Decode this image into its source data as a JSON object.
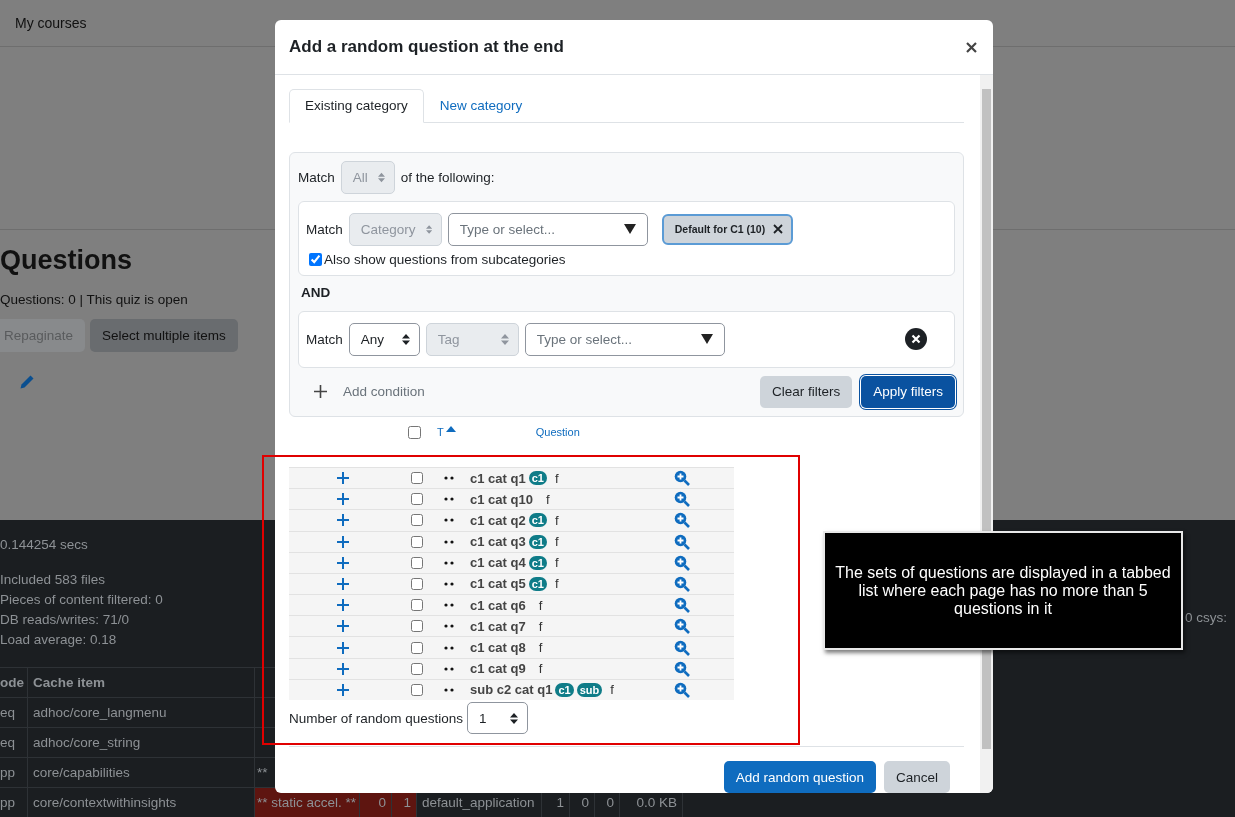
{
  "page": {
    "nav_link": "My courses",
    "heading": "Questions",
    "summary": "Questions: 0 | This quiz is open",
    "buttons": [
      {
        "label": "Repaginate",
        "disabled": true
      },
      {
        "label": "Select multiple items",
        "disabled": false
      }
    ]
  },
  "footer": {
    "stats": [
      "0.144254 secs",
      "Included 583 files",
      "Pieces of content filtered: 0",
      "DB reads/writes: 71/0",
      "Load average: 0.18"
    ],
    "side_stat": "0 csys:",
    "table": {
      "columns": [
        "ode",
        "Cache item"
      ],
      "rows": [
        {
          "cells": [
            "eq",
            "adhoc/core_langmenu"
          ],
          "flagged": false
        },
        {
          "cells": [
            "eq",
            "adhoc/core_string"
          ],
          "flagged": false
        },
        {
          "cells": [
            "pp",
            "core/capabilities",
            "**"
          ],
          "flagged": false
        },
        {
          "cells": [
            "pp",
            "core/contextwithinsights",
            "** static accel. **",
            "0",
            "1",
            "default_application",
            "1",
            "0",
            "0",
            "0.0 KB"
          ],
          "flagged": true
        }
      ]
    }
  },
  "dialog": {
    "title": "Add a random question at the end",
    "tabs": [
      {
        "label": "Existing category",
        "selected": true
      },
      {
        "label": "New category",
        "selected": false
      }
    ],
    "filter": {
      "match_label": "Match",
      "match_value": "All",
      "match_disabled": true,
      "match_suffix": "of the following:",
      "conditions": [
        {
          "kind": "category",
          "match_label": "Match",
          "field": "Category",
          "field_disabled": true,
          "placeholder": "Type or select...",
          "chips": [
            "Default for C1 (10)"
          ],
          "option": {
            "label": "Also show questions from subcategories",
            "checked": true
          }
        },
        {
          "kind": "tag",
          "match_label": "Match",
          "join": "Any",
          "join_disabled": false,
          "field": "Tag",
          "field_disabled": true,
          "placeholder": "Type or select..."
        }
      ],
      "joiner": "AND",
      "add_label": "Add condition",
      "buttons": [
        {
          "label": "Clear filters",
          "kind": "secondary"
        },
        {
          "label": "Apply filters",
          "kind": "primary"
        }
      ]
    },
    "table": {
      "select_all_checked": false,
      "columns": [
        {
          "label": "T",
          "sorted": true
        },
        {
          "label": "Question",
          "sorted": false
        }
      ],
      "rows": [
        {
          "name": "c1 cat q1",
          "tags": [
            "c1"
          ],
          "suffix": "f",
          "checked": false
        },
        {
          "name": "c1 cat q10",
          "tags": [],
          "suffix": "f",
          "checked": false
        },
        {
          "name": "c1 cat q2",
          "tags": [
            "c1"
          ],
          "suffix": "f",
          "checked": false
        },
        {
          "name": "c1 cat q3",
          "tags": [
            "c1"
          ],
          "suffix": "f",
          "checked": false
        },
        {
          "name": "c1 cat q4",
          "tags": [
            "c1"
          ],
          "suffix": "f",
          "checked": false
        },
        {
          "name": "c1 cat q5",
          "tags": [
            "c1"
          ],
          "suffix": "f",
          "checked": false
        },
        {
          "name": "c1 cat q6",
          "tags": [],
          "suffix": "f",
          "checked": false
        },
        {
          "name": "c1 cat q7",
          "tags": [],
          "suffix": "f",
          "checked": false
        },
        {
          "name": "c1 cat q8",
          "tags": [],
          "suffix": "f",
          "checked": false
        },
        {
          "name": "c1 cat q9",
          "tags": [],
          "suffix": "f",
          "checked": false
        },
        {
          "name": "sub c2 cat q1",
          "tags": [
            "c1",
            "sub"
          ],
          "suffix": "f",
          "checked": false
        }
      ]
    },
    "count": {
      "label": "Number of random questions",
      "value": "1"
    },
    "buttons": [
      {
        "label": "Add random question",
        "kind": "primary"
      },
      {
        "label": "Cancel",
        "kind": "secondary"
      }
    ]
  },
  "annotation": {
    "text": "The sets of questions are displayed in a tabbed list where each page has no more than 5 questions in it"
  }
}
